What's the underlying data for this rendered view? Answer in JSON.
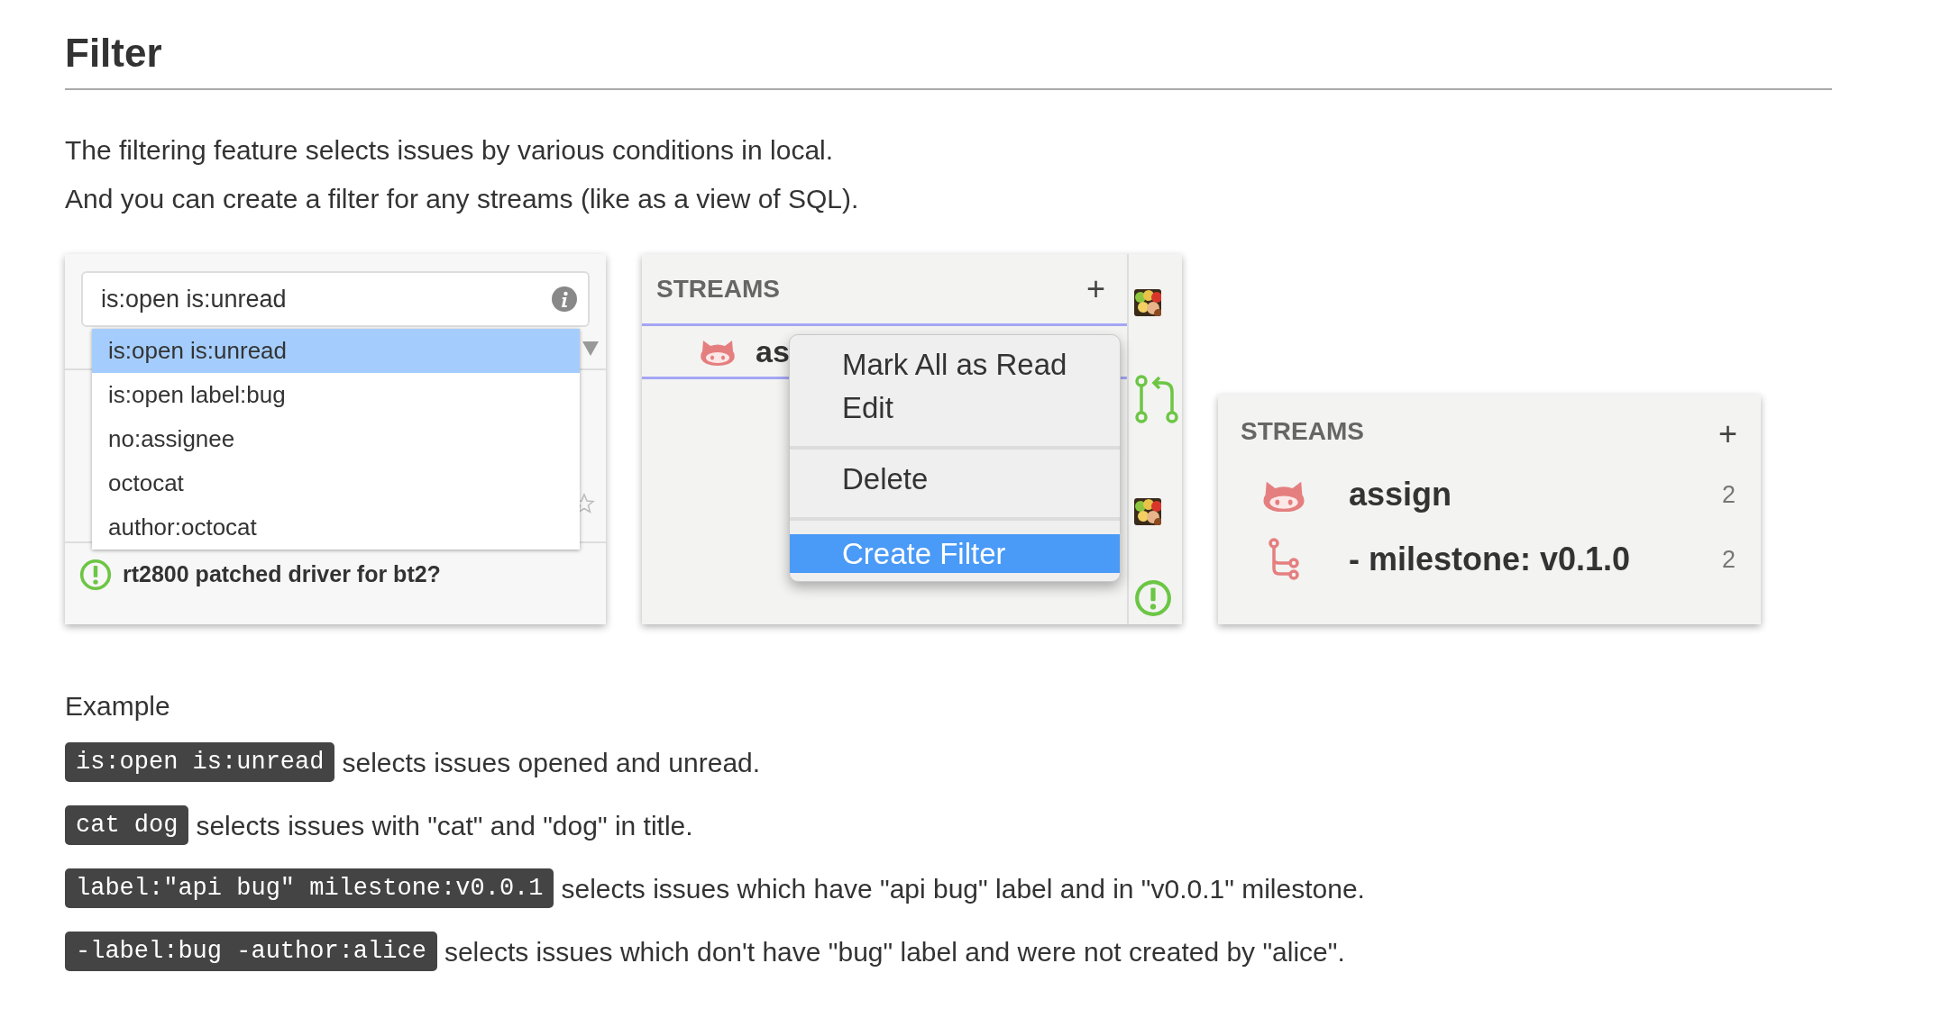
{
  "heading": "Filter",
  "intro": [
    "The filtering feature selects issues by various conditions in local.",
    "And you can create a filter for any streams (like as a view of SQL)."
  ],
  "filter_box": {
    "query": "is:open is:unread",
    "suggestions": [
      {
        "label": "is:open is:unread",
        "selected": true
      },
      {
        "label": "is:open label:bug",
        "selected": false
      },
      {
        "label": "no:assignee",
        "selected": false
      },
      {
        "label": "octocat",
        "selected": false
      },
      {
        "label": "author:octocat",
        "selected": false
      }
    ],
    "issue_title": "rt2800 patched driver for bt2?"
  },
  "menu_screen": {
    "header": "STREAMS",
    "add": "+",
    "stream": {
      "name": "as",
      "selected": true
    },
    "menu": [
      {
        "label": "Mark All as Read",
        "separator_before": false,
        "selected": false
      },
      {
        "label": "Edit",
        "separator_before": false,
        "selected": false
      },
      {
        "label": "Delete",
        "separator_before": true,
        "selected": false
      },
      {
        "label": "Create Filter",
        "separator_before": true,
        "selected": true
      }
    ]
  },
  "result_screen": {
    "header": "STREAMS",
    "add": "+",
    "streams": [
      {
        "kind": "stream",
        "name": "assign",
        "count": "2"
      },
      {
        "kind": "filter",
        "name": "- milestone: v0.1.0",
        "count": "2"
      }
    ]
  },
  "example": {
    "title": "Example",
    "rows": [
      {
        "code": "is:open is:unread",
        "text": "selects issues opened and unread."
      },
      {
        "code": "cat dog",
        "text": "selects issues with \"cat\" and \"dog\" in title."
      },
      {
        "code": "label:\"api bug\" milestone:v0.0.1",
        "text": "selects issues which have \"api bug\" label and in \"v0.0.1\" milestone."
      },
      {
        "code": "-label:bug -author:alice",
        "text": "selects issues which don't have \"bug\" label and were not created by \"alice\"."
      }
    ]
  }
}
